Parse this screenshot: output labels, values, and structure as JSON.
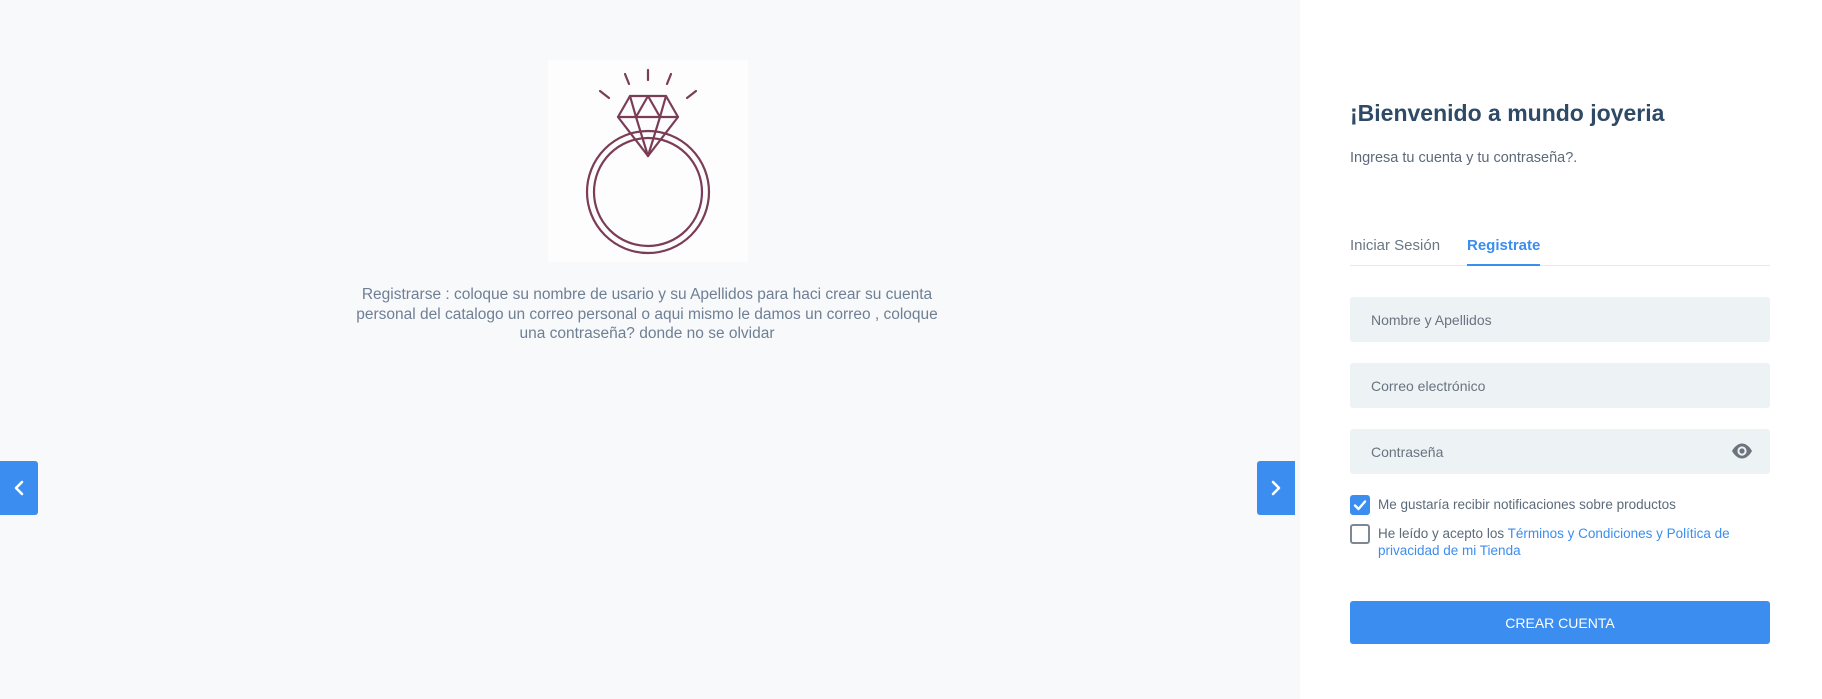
{
  "carousel": {
    "image_icon": "diamond-ring-icon",
    "caption": "Registrarse : coloque su nombre de usario y su Apellidos para haci crear su cuenta personal del catalogo un correo personal o aqui mismo le damos un correo , coloque una contraseña? donde no se olvidar",
    "prev_icon": "chevron-left-icon",
    "next_icon": "chevron-right-icon"
  },
  "panel": {
    "title": "¡Bienvenido a mundo joyeria",
    "subtitle": "Ingresa tu cuenta y tu contraseña?.",
    "tabs": [
      {
        "label": "Iniciar Sesión",
        "active": false
      },
      {
        "label": "Registrate",
        "active": true
      }
    ],
    "fields": {
      "name": {
        "placeholder": "Nombre y Apellidos",
        "value": ""
      },
      "email": {
        "placeholder": "Correo electrónico",
        "value": ""
      },
      "password": {
        "placeholder": "Contraseña",
        "value": "",
        "toggle_icon": "eye-icon"
      }
    },
    "checkboxes": {
      "notifications": {
        "label": "Me gustaría recibir notificaciones sobre productos",
        "checked": true
      },
      "terms": {
        "label_prefix": "He leído y acepto los ",
        "link_text": "Términos y Condiciones y Política de privacidad de mi Tienda",
        "checked": false
      }
    },
    "submit_label": "CREAR CUENTA"
  },
  "colors": {
    "accent": "#3b8df0",
    "title": "#2f4a66",
    "field_bg": "#edf2f5",
    "ring": "#7a3d55"
  }
}
